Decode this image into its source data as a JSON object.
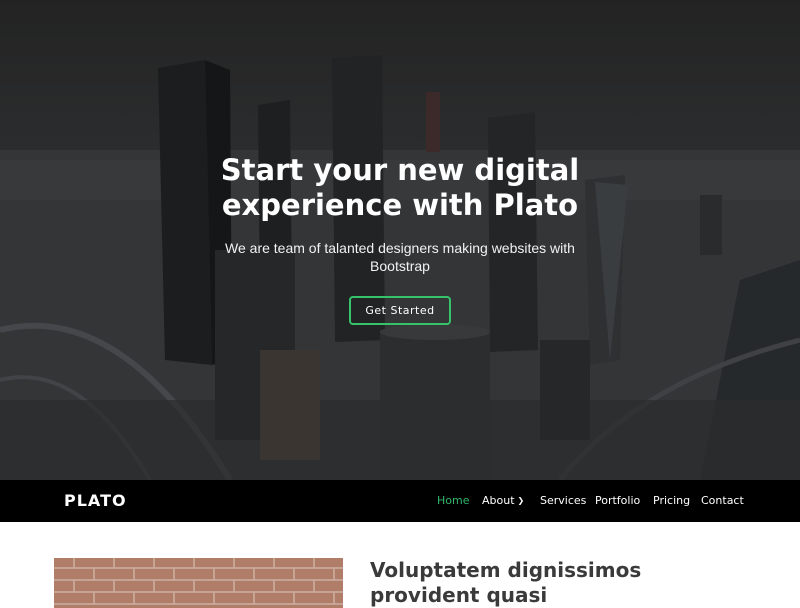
{
  "hero": {
    "title": "Start your new digital experience with Plato",
    "subtitle": "We are team of talanted designers making websites with Bootstrap",
    "cta_label": "Get Started"
  },
  "navbar": {
    "brand": "PLATO",
    "items": [
      {
        "label": "Home",
        "active": true
      },
      {
        "label": "About",
        "dropdown": true
      },
      {
        "label": "Services"
      },
      {
        "label": "Portfolio"
      },
      {
        "label": "Pricing"
      },
      {
        "label": "Contact"
      }
    ]
  },
  "article": {
    "title": "Voluptatem dignissimos provident quasi"
  },
  "colors": {
    "accent": "#34c26a",
    "nav_bg": "#000000",
    "active_link": "#2fb86a"
  },
  "icons": [
    "chevron-down-icon"
  ]
}
